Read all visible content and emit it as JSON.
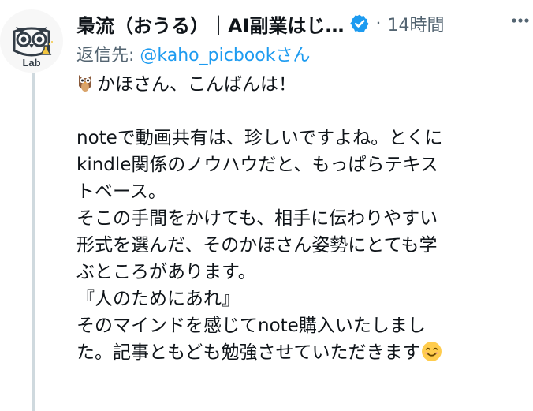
{
  "tweet": {
    "author": {
      "display_name": "梟流（おうる）｜AI副業はじ…",
      "avatar_label": "Lab",
      "verified": true,
      "verified_color": "#1d9bf0"
    },
    "time_separator": "·",
    "timestamp": "14時間",
    "reply_prefix": "返信先: ",
    "reply_handle": "@kaho_picbookさん",
    "icons": {
      "verified": "verified-badge-icon",
      "more": "more-options-icon",
      "owl_emoji": "owl-emoji-icon",
      "smile_emoji": "smiling-face-emoji-icon"
    },
    "lines": {
      "greeting": "かほさん、こんばんは！",
      "l1": "noteで動画共有は、珍しいですよね。とくに",
      "l2": "kindle関係のノウハウだと、もっぱらテキス",
      "l3": "トベース。",
      "l4": "そこの手間をかけても、相手に伝わりやすい",
      "l5": "形式を選んだ、そのかほさん姿勢にとても学",
      "l6": "ぶところがあります。",
      "l7": "『人のためにあれ』",
      "l8": "そのマインドを感じてnote購入いたしまし",
      "l9": "た。記事ともども勉強させていただきます"
    },
    "colors": {
      "text": "#0f1419",
      "secondary": "#536471",
      "link": "#1d9bf0",
      "thread_line": "#cfd9de"
    }
  }
}
